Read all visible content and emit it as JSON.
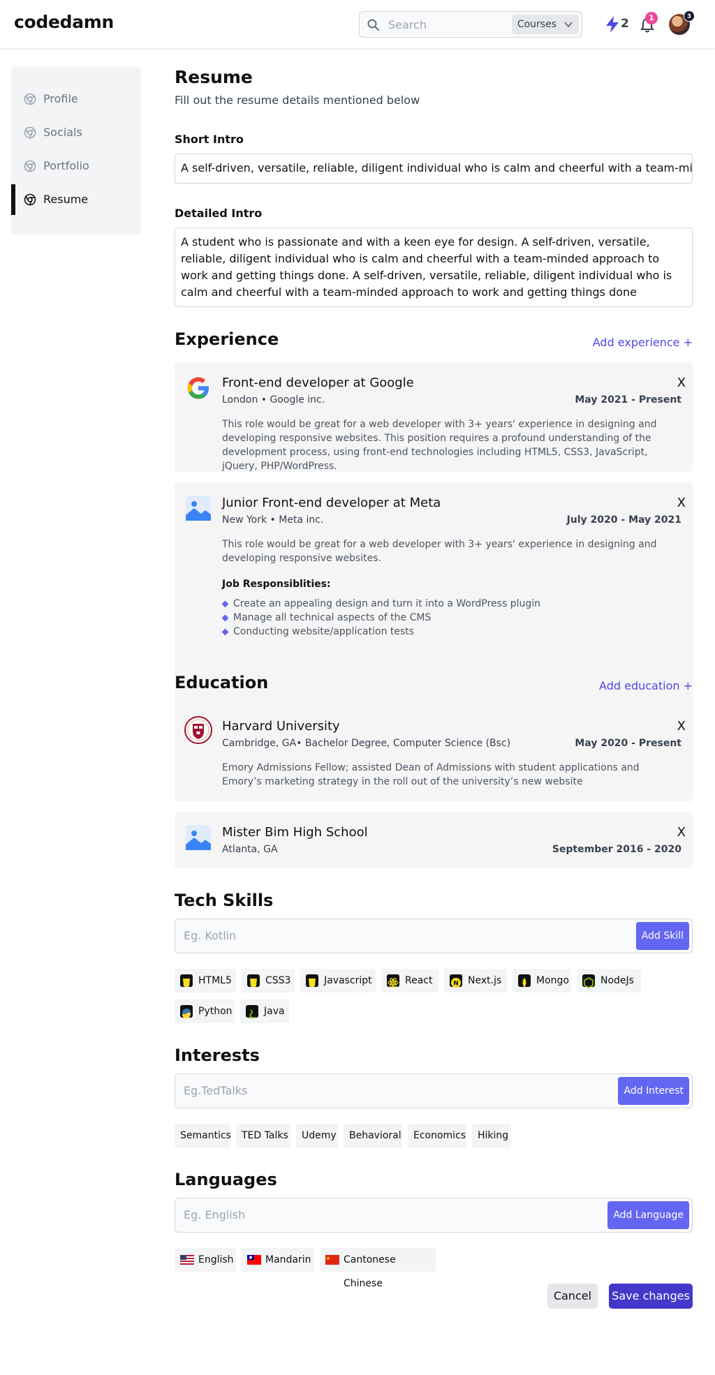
{
  "header": {
    "logo": "codedamn",
    "search_placeholder": "Search",
    "courses_label": "Courses",
    "bolt_count": "2",
    "notification_count": "1",
    "avatar_badge": "3"
  },
  "sidebar": {
    "items": [
      {
        "label": "Profile",
        "active": false
      },
      {
        "label": "Socials",
        "active": false
      },
      {
        "label": "Portfolio",
        "active": false
      },
      {
        "label": "Resume",
        "active": true
      }
    ]
  },
  "resume": {
    "title": "Resume",
    "subtitle": "Fill out the resume details mentioned below",
    "short_intro_label": "Short Intro",
    "short_intro_value": "A self-driven, versatile, reliable, diligent individual who is calm and cheerful with a team-minded approach to work and getting things done",
    "detailed_intro_label": "Detailed Intro",
    "detailed_intro_value": "A student who is passionate and with a keen eye for design. A self-driven, versatile, reliable, diligent individual who is calm and cheerful with a team-minded approach to work and getting things done. A self-driven, versatile, reliable, diligent individual who is calm and cheerful with a team-minded approach to work and getting things done"
  },
  "experience": {
    "title": "Experience",
    "add_label": "Add experience +",
    "items": [
      {
        "title": "Front-end developer at Google",
        "meta": "London • Google inc.",
        "date": "May 2021 - Present",
        "close": "X",
        "description": "This role would be great for a web developer with 3+ years' experience in designing and developing responsive websites. This position requires a profound understanding of the development process, using front-end technologies including HTML5, CSS3, JavaScript, jQuery, PHP/WordPress."
      },
      {
        "title": "Junior Front-end developer at Meta",
        "meta": "New York • Meta inc.",
        "date": "July 2020 - May 2021",
        "close": "X",
        "description": "This role would be great for a web developer with 3+ years' experience in designing and developing responsive websites.",
        "responsibilities_title": "Job Responsiblities:",
        "responsibilities": [
          "Create an appealing design and turn it into a WordPress plugin",
          "Manage all technical aspects of the CMS",
          "Conducting website/application tests"
        ]
      }
    ]
  },
  "education": {
    "title": "Education",
    "add_label": "Add education +",
    "items": [
      {
        "title": "Harvard University",
        "meta": "Cambridge, GA• Bachelor Degree, Computer Science (Bsc)",
        "date": "May 2020 - Present",
        "close": "X",
        "description": "Emory Admissions Fellow; assisted Dean of Admissions with student applications and Emory’s marketing strategy in the roll out of the university’s new website"
      },
      {
        "title": "Mister Bim High School",
        "meta": "Atlanta, GA",
        "date": "September 2016 - 2020",
        "close": "X"
      }
    ]
  },
  "tech_skills": {
    "title": "Tech Skills",
    "placeholder": "Eg. Kotlin",
    "button": "Add Skill",
    "chips": [
      {
        "label": "HTML5",
        "icon": "html5-icon",
        "color": "#f7df1e"
      },
      {
        "label": "CSS3",
        "icon": "css3-icon",
        "color": "#f7df1e"
      },
      {
        "label": "Javascript",
        "icon": "javascript-icon",
        "color": "#f7df1e"
      },
      {
        "label": "React",
        "icon": "react-icon",
        "color": "#f7df1e"
      },
      {
        "label": "Next.js",
        "icon": "nextjs-icon",
        "color": "#f7df1e"
      },
      {
        "label": "Mongo",
        "icon": "mongo-icon",
        "color": "#f7df1e"
      },
      {
        "label": "NodeJs",
        "icon": "nodejs-icon",
        "color": "#84cc16"
      },
      {
        "label": "Python",
        "icon": "python-icon",
        "color": "#3776ab"
      },
      {
        "label": "Java",
        "icon": "java-icon",
        "color": "#84cc16"
      }
    ]
  },
  "interests": {
    "title": "Interests",
    "placeholder": "Eg.TedTalks",
    "button": "Add Interest",
    "chips": [
      "Semantics",
      "TED Talks",
      "Udemy",
      "Behavioral",
      "Economics",
      "Hiking"
    ]
  },
  "languages": {
    "title": "Languages",
    "placeholder": "Eg. English",
    "button": "Add Language",
    "chips": [
      {
        "label": "English",
        "flag": "us-flag-icon"
      },
      {
        "label": "Mandarin",
        "flag": "taiwan-flag-icon"
      },
      {
        "label": "Cantonese Chinese",
        "flag": "china-flag-icon"
      }
    ]
  },
  "actions": {
    "cancel": "Cancel",
    "save": "Save changes"
  },
  "colors": {
    "accent": "#4f46e5",
    "button": "#6366f1",
    "save": "#4338ca",
    "notification": "#ec4899"
  }
}
